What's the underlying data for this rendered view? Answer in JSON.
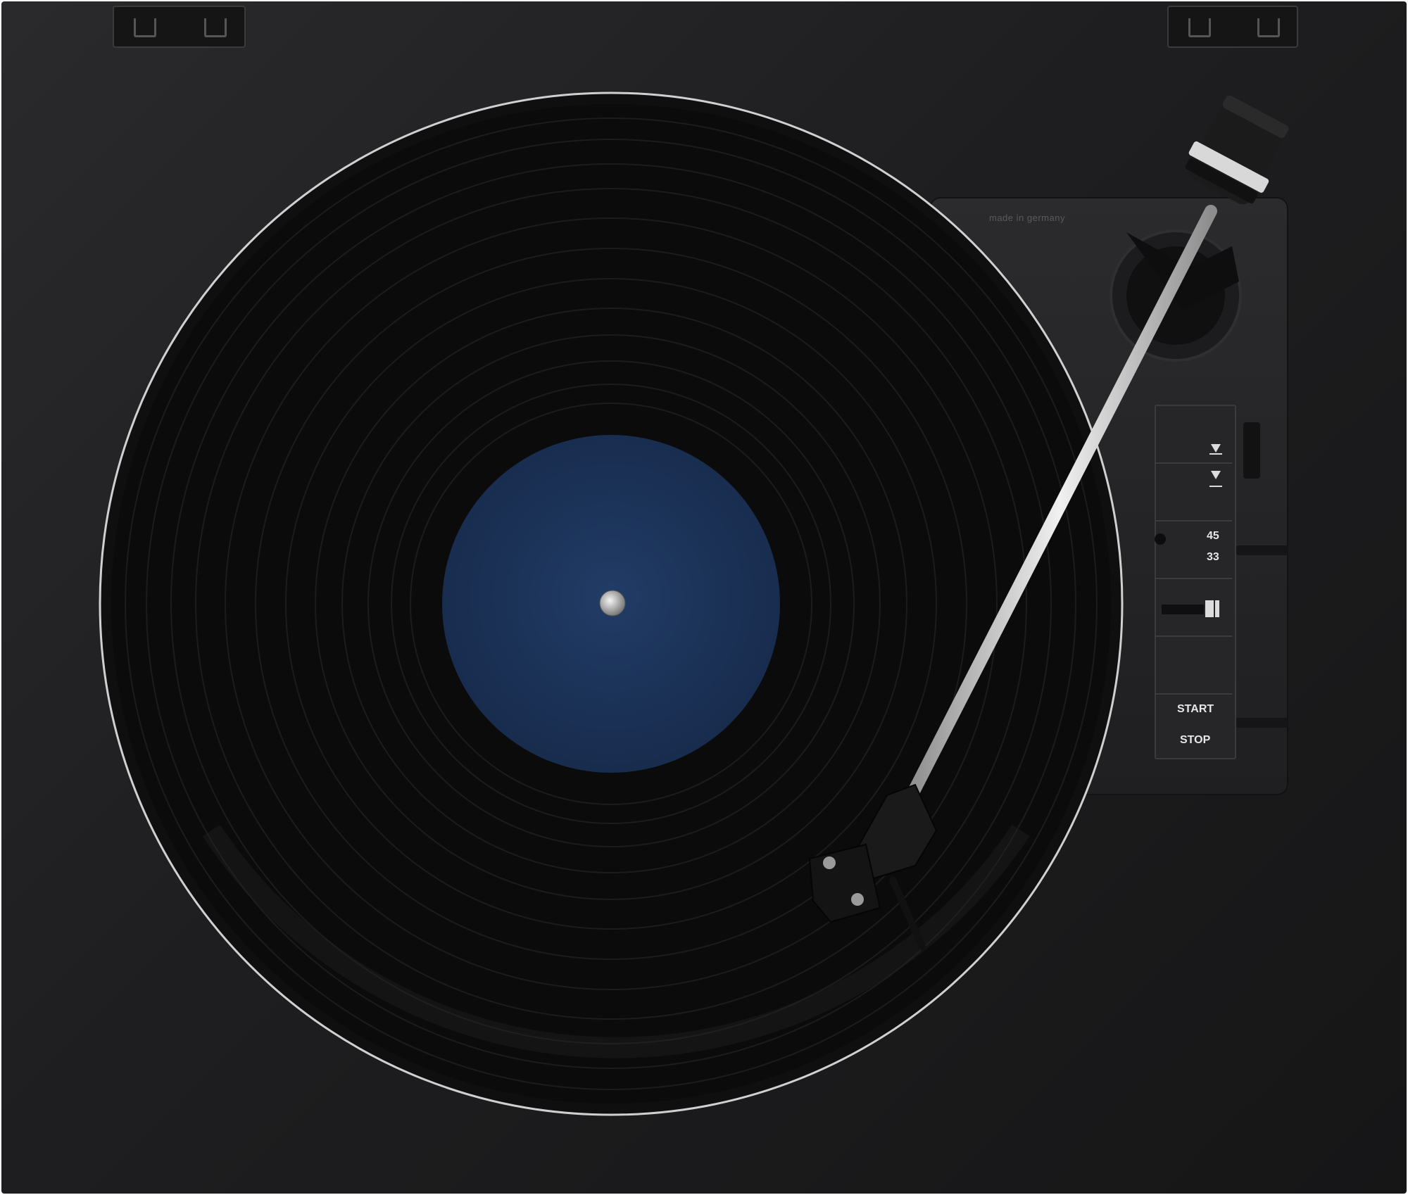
{
  "scene": {
    "description_alt": "Top view of a black turntable with a vinyl record and tonearm"
  },
  "panel": {
    "made_in": "made in germany",
    "speed_high": "45",
    "speed_low": "33",
    "start_label": "START",
    "stop_label": "STOP"
  },
  "colors": {
    "plinth": "#1e1e20",
    "record": "#0b0b0c",
    "label": "#1d3358",
    "tonearm": "#c9c9c9"
  }
}
